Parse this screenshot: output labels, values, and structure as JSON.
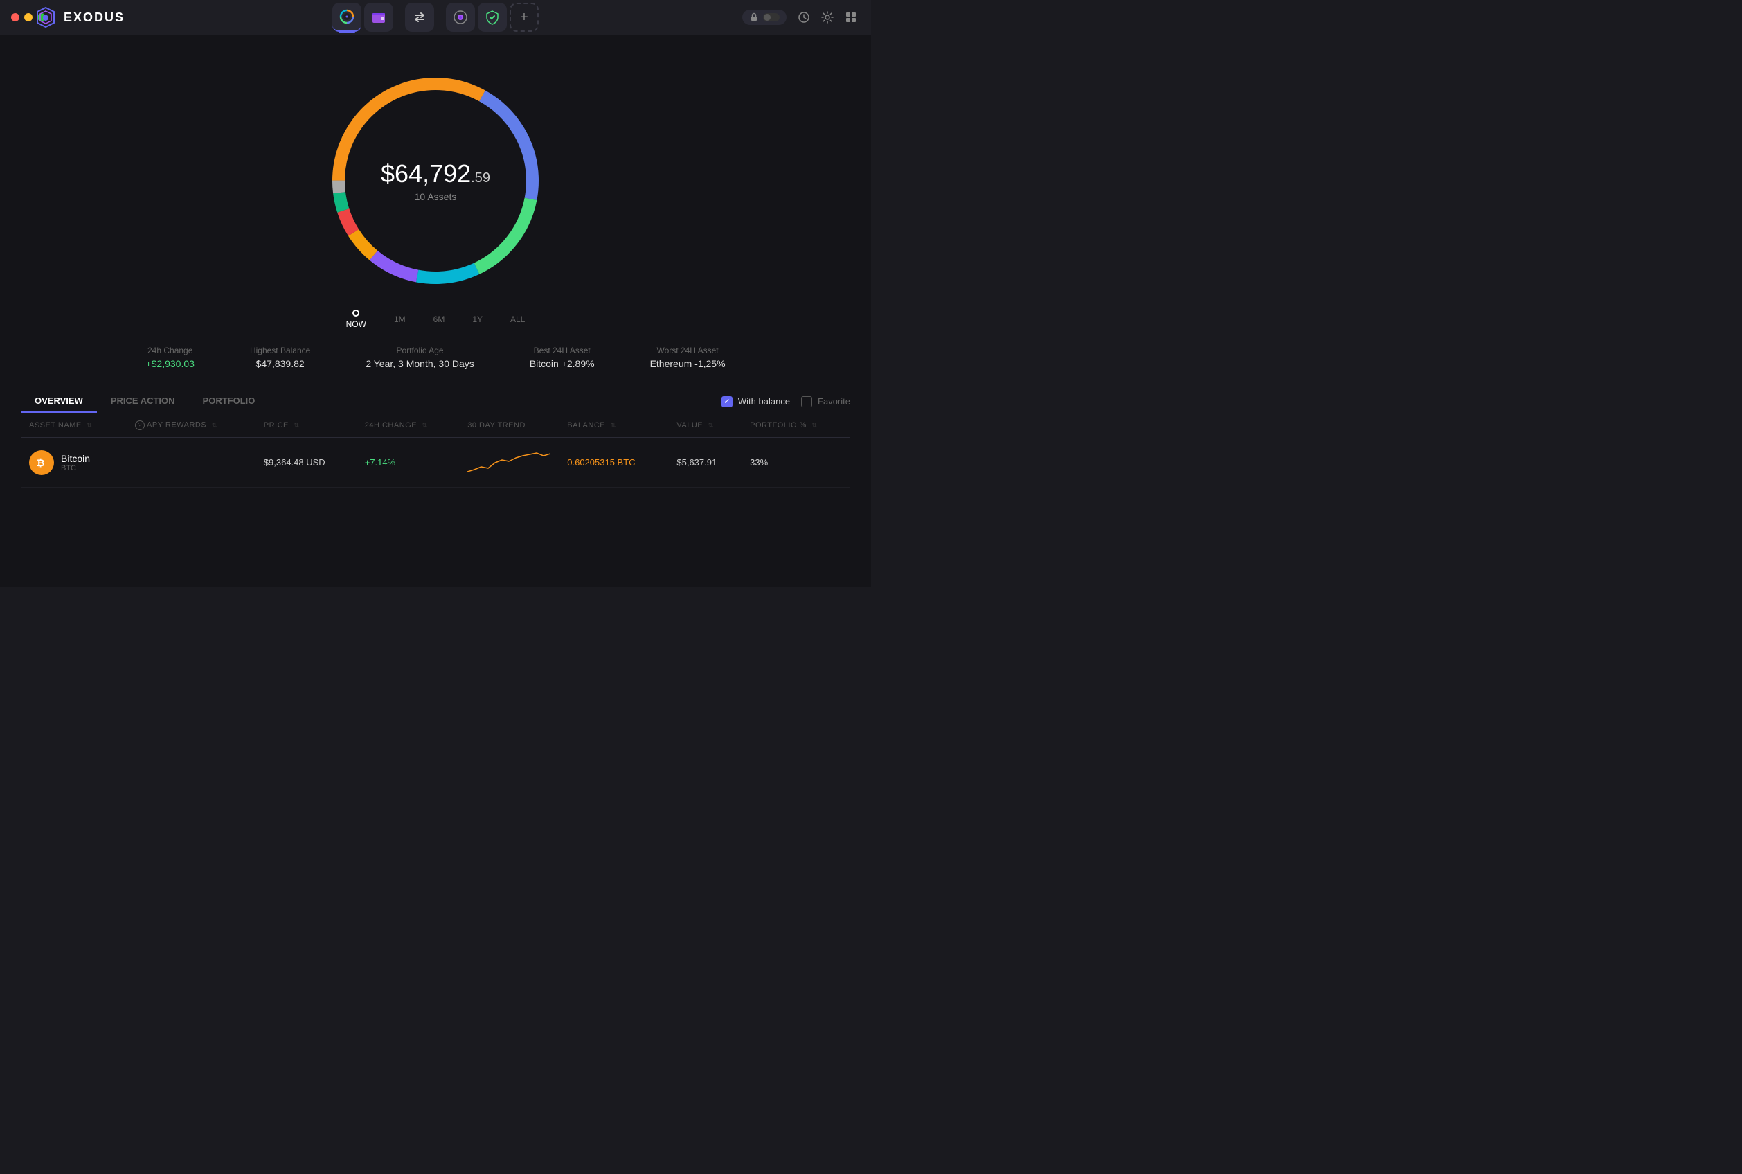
{
  "app": {
    "title": "EXODUS",
    "traffic_lights": [
      "close",
      "minimize",
      "maximize"
    ]
  },
  "nav": {
    "tabs": [
      {
        "id": "portfolio",
        "label": "Portfolio",
        "active": true,
        "icon": "circle-icon"
      },
      {
        "id": "wallet",
        "label": "Wallet",
        "active": false,
        "icon": "wallet-icon"
      },
      {
        "id": "exchange",
        "label": "Exchange",
        "active": false,
        "icon": "exchange-icon"
      },
      {
        "id": "apps",
        "label": "Apps",
        "active": false,
        "icon": "apps-icon"
      },
      {
        "id": "passport",
        "label": "Passport",
        "active": false,
        "icon": "passport-icon"
      }
    ],
    "add_label": "+",
    "lock_label": "",
    "history_label": "",
    "settings_label": "",
    "grid_label": ""
  },
  "portfolio": {
    "amount_prefix": "$",
    "amount_main": "64,792",
    "amount_cents": ".59",
    "assets_label": "10 Assets",
    "timeline": {
      "items": [
        {
          "id": "now",
          "label": "NOW",
          "active": true
        },
        {
          "id": "1m",
          "label": "1M",
          "active": false
        },
        {
          "id": "6m",
          "label": "6M",
          "active": false
        },
        {
          "id": "1y",
          "label": "1Y",
          "active": false
        },
        {
          "id": "all",
          "label": "ALL",
          "active": false
        }
      ]
    }
  },
  "stats": {
    "items": [
      {
        "label": "24h Change",
        "value": "+$2,930.03",
        "positive": true
      },
      {
        "label": "Highest Balance",
        "value": "$47,839.82",
        "positive": false
      },
      {
        "label": "Portfolio Age",
        "value": "2 Year, 3 Month, 30 Days",
        "positive": false
      },
      {
        "label": "Best 24H Asset",
        "value": "Bitcoin +2.89%",
        "positive": false
      },
      {
        "label": "Worst 24H Asset",
        "value": "Ethereum -1,25%",
        "positive": false
      }
    ]
  },
  "table": {
    "tabs": [
      {
        "id": "overview",
        "label": "OVERVIEW",
        "active": true
      },
      {
        "id": "price-action",
        "label": "PRICE ACTION",
        "active": false
      },
      {
        "id": "portfolio",
        "label": "PORTFOLIO",
        "active": false
      }
    ],
    "filters": {
      "with_balance_label": "With balance",
      "with_balance_checked": true,
      "favorite_label": "Favorite",
      "favorite_checked": false
    },
    "columns": [
      {
        "id": "asset-name",
        "label": "ASSET NAME",
        "sortable": true
      },
      {
        "id": "apy-rewards",
        "label": "APY REWARDS",
        "sortable": true,
        "has_help": true
      },
      {
        "id": "price",
        "label": "PRICE",
        "sortable": true
      },
      {
        "id": "24h-change",
        "label": "24H CHANGE",
        "sortable": true
      },
      {
        "id": "30-day-trend",
        "label": "30 DAY TREND",
        "sortable": false
      },
      {
        "id": "balance",
        "label": "BALANCE",
        "sortable": true
      },
      {
        "id": "value",
        "label": "VALUE",
        "sortable": true
      },
      {
        "id": "portfolio-pct",
        "label": "PORTFOLIO %",
        "sortable": true
      }
    ],
    "rows": [
      {
        "id": "bitcoin",
        "icon": "₿",
        "icon_bg": "#f7931a",
        "name": "Bitcoin",
        "ticker": "BTC",
        "apy": "",
        "price": "$9,364.48 USD",
        "change": "+7.14%",
        "change_positive": true,
        "balance": "0.60205315 BTC",
        "balance_color": "#f7931a",
        "value": "$5,637.91",
        "portfolio_pct": "33%"
      }
    ]
  },
  "donut": {
    "segments": [
      {
        "color": "#f7931a",
        "pct": 33,
        "offset": 0
      },
      {
        "color": "#627eea",
        "pct": 20,
        "offset": 33
      },
      {
        "color": "#4ade80",
        "pct": 15,
        "offset": 53
      },
      {
        "color": "#06b6d4",
        "pct": 10,
        "offset": 68
      },
      {
        "color": "#8b5cf6",
        "pct": 8,
        "offset": 78
      },
      {
        "color": "#f59e0b",
        "pct": 5,
        "offset": 86
      },
      {
        "color": "#ef4444",
        "pct": 4,
        "offset": 91
      },
      {
        "color": "#10b981",
        "pct": 3,
        "offset": 95
      },
      {
        "color": "#aaa",
        "pct": 2,
        "offset": 98
      }
    ]
  }
}
